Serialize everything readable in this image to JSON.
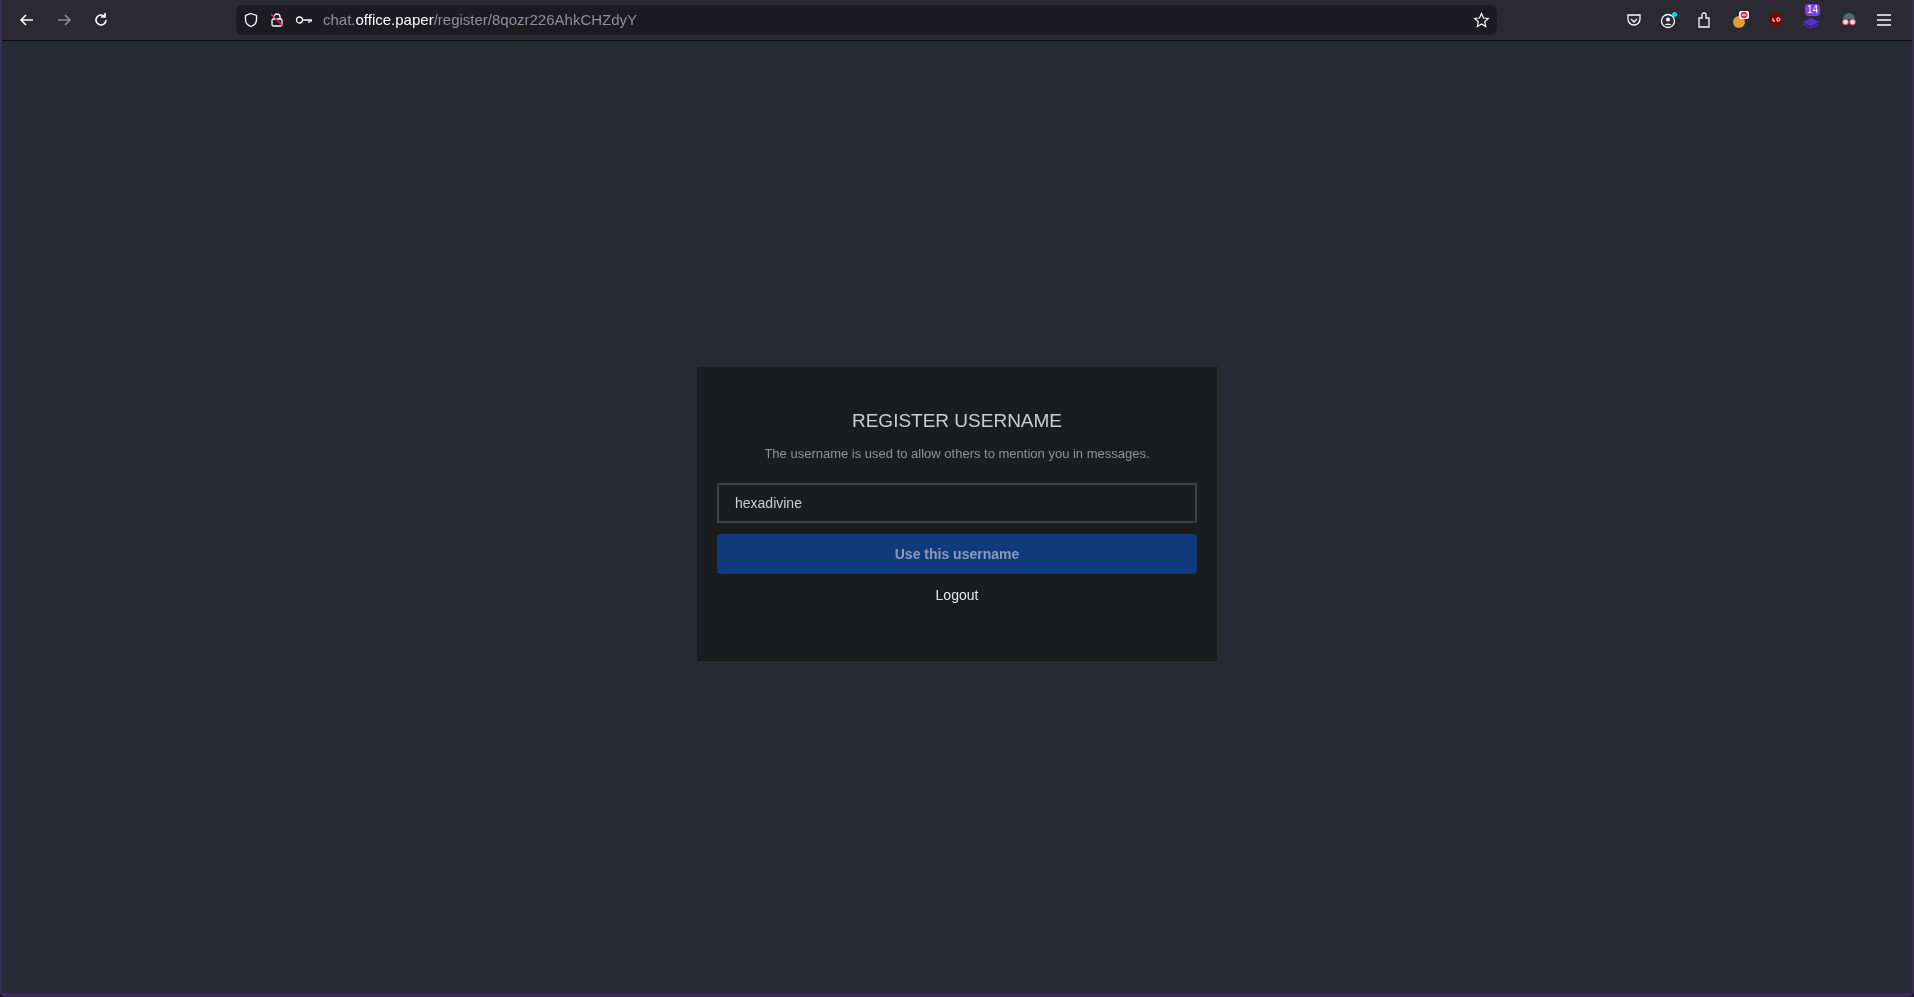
{
  "browser": {
    "url": {
      "subdomain": "chat.",
      "domain": "office.paper",
      "path": "/register/8qozr226AhkCHZdyY"
    },
    "extension_badge": "14"
  },
  "dialog": {
    "title": "REGISTER USERNAME",
    "description": "The username is used to allow others to mention you in messages.",
    "username_field": {
      "value": "hexadivine"
    },
    "submit_button": {
      "label": "Use this username",
      "disabled": true
    },
    "logout_link": "Logout"
  }
}
